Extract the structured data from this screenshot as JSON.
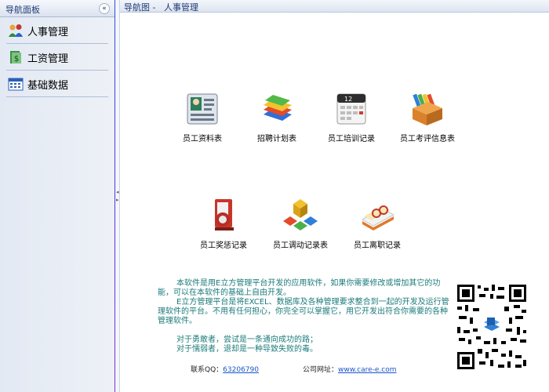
{
  "nav": {
    "header_title": "导航面板",
    "collapse_glyph": "«",
    "items": [
      {
        "label": "人事管理",
        "icon": "people-icon"
      },
      {
        "label": "工资管理",
        "icon": "money-icon"
      },
      {
        "label": "基础数据",
        "icon": "calendar-grid-icon"
      }
    ]
  },
  "breadcrumb": "导航图 -   人事管理",
  "tiles": [
    {
      "label": "员工资料表",
      "icon": "id-card-icon"
    },
    {
      "label": "招聘计划表",
      "icon": "books-icon"
    },
    {
      "label": "员工培训记录",
      "icon": "calendar-icon"
    },
    {
      "label": "员工考评信息表",
      "icon": "files-box-icon"
    },
    {
      "label": "员工奖惩记录",
      "icon": "red-folder-icon"
    },
    {
      "label": "员工调动记录表",
      "icon": "blocks-icon"
    },
    {
      "label": "员工离职记录",
      "icon": "document-glasses-icon"
    }
  ],
  "info": {
    "para1": "本软件是用E立方管理平台开发的应用软件，如果你需要修改或增加其它的功能，可以在本软件的基础上自由开发。",
    "para2": "E立方管理平台是将EXCEL、数据库及各种管理要求整合到一起的开发及运行管理软件的平台。不用有任何担心，你完全可以掌握它，用它开发出符合你需要的各种管理软件。",
    "quote1": "对于勇敢者，尝试是一条通向成功的路；",
    "quote2": "对于懦弱者，退却是一种导致失败的毒。"
  },
  "footer": {
    "qq_label": "联系QQ：",
    "qq_value": "63206790",
    "site_label": "公司网址：",
    "site_value": "www.care-e.com"
  },
  "colors": {
    "info_text": "#1c7a7a",
    "nav_accent": "#5a2fe0",
    "link": "#1a55c8"
  }
}
